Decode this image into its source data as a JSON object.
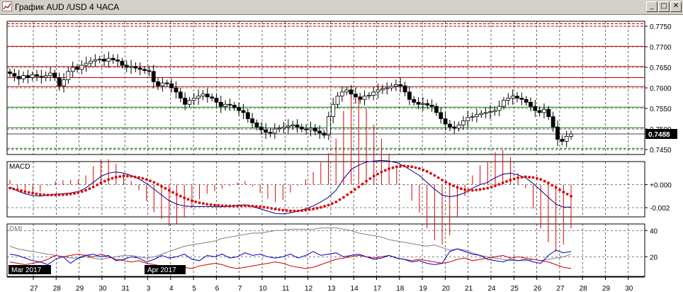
{
  "window": {
    "title": "График AUD /USD  4 ЧАСА",
    "buttons": {
      "minimize": "_",
      "maximize": "□",
      "close": "✕"
    }
  },
  "colors": {
    "background": "#ffffff",
    "grid": "#000000",
    "hline_red": "#c00000",
    "hline_green": "#008000",
    "macd_line": "#000080",
    "signal_dots": "#e00000",
    "histogram": "#e00000",
    "adx": "#808080",
    "di_plus": "#0000c0",
    "di_minus": "#d00000"
  },
  "chart_data": [
    {
      "type": "candlestick",
      "title": "График AUD /USD  4 ЧАСА",
      "current_price_label": "0.7488",
      "y_ticks": [
        "0.7750",
        "0.7700",
        "0.7650",
        "0.7600",
        "0.7550",
        "0.7500",
        "0.7450"
      ],
      "ylim": [
        0.7438,
        0.7762
      ],
      "horizontal_levels": [
        {
          "value": 0.7756,
          "color": "red",
          "style": "dashed"
        },
        {
          "value": 0.775,
          "color": "red",
          "style": "dashed"
        },
        {
          "value": 0.7701,
          "color": "red",
          "style": "solid"
        },
        {
          "value": 0.7652,
          "color": "red",
          "style": "solid"
        },
        {
          "value": 0.7625,
          "color": "red",
          "style": "solid"
        },
        {
          "value": 0.7603,
          "color": "red",
          "style": "solid"
        },
        {
          "value": 0.7553,
          "color": "green",
          "style": "solid"
        },
        {
          "value": 0.7503,
          "color": "green",
          "style": "solid"
        },
        {
          "value": 0.7453,
          "color": "green",
          "style": "dashed"
        }
      ],
      "closes": [
        0.7635,
        0.7628,
        0.7622,
        0.763,
        0.7625,
        0.7632,
        0.7628,
        0.7626,
        0.763,
        0.7636,
        0.7625,
        0.7605,
        0.762,
        0.764,
        0.765,
        0.7645,
        0.7655,
        0.766,
        0.7665,
        0.7668,
        0.767,
        0.7665,
        0.7672,
        0.7668,
        0.7665,
        0.7655,
        0.765,
        0.7652,
        0.7648,
        0.7645,
        0.7642,
        0.764,
        0.7615,
        0.7605,
        0.7612,
        0.761,
        0.76,
        0.759,
        0.7575,
        0.756,
        0.757,
        0.7575,
        0.758,
        0.7585,
        0.7578,
        0.7575,
        0.7565,
        0.7555,
        0.756,
        0.7558,
        0.7552,
        0.7545,
        0.754,
        0.7525,
        0.7515,
        0.7505,
        0.7498,
        0.7492,
        0.749,
        0.75,
        0.7502,
        0.7505,
        0.7508,
        0.751,
        0.7505,
        0.75,
        0.7498,
        0.7502,
        0.7495,
        0.749,
        0.7485,
        0.753,
        0.756,
        0.758,
        0.759,
        0.7595,
        0.7585,
        0.7578,
        0.7572,
        0.758,
        0.7582,
        0.759,
        0.7595,
        0.7598,
        0.76,
        0.7604,
        0.7608,
        0.7605,
        0.759,
        0.7572,
        0.7565,
        0.756,
        0.7562,
        0.7558,
        0.7555,
        0.754,
        0.7525,
        0.7512,
        0.7505,
        0.7502,
        0.751,
        0.752,
        0.7528,
        0.753,
        0.7535,
        0.7538,
        0.754,
        0.7542,
        0.7545,
        0.7555,
        0.757,
        0.7575,
        0.758,
        0.7575,
        0.7572,
        0.7565,
        0.7555,
        0.7545,
        0.754,
        0.7548,
        0.753,
        0.7505,
        0.7475,
        0.747,
        0.7482,
        0.7488
      ],
      "macd": {
        "label": "MACD",
        "y_ticks": [
          "+0.000",
          "-0.002"
        ],
        "ylim": [
          -0.0028,
          0.002
        ],
        "macd_line": [
          -0.0002,
          -0.00055,
          -0.0008,
          -0.00095,
          -0.001,
          -0.00092,
          -0.00083,
          -0.00078,
          -0.00072,
          -0.0006,
          -0.0003,
          0.0002,
          0.0007,
          0.001,
          0.0011,
          0.001,
          0.0008,
          0.0005,
          0.0001,
          -0.0004,
          -0.0009,
          -0.0014,
          -0.0017,
          -0.00185,
          -0.0019,
          -0.0019,
          -0.0019,
          -0.00192,
          -0.00192,
          -0.00188,
          -0.0018,
          -0.00175,
          -0.0019,
          -0.0021,
          -0.0023,
          -0.0025,
          -0.00255,
          -0.00245,
          -0.0023,
          -0.0021,
          -0.00185,
          -0.0015,
          -0.0011,
          -0.0005,
          0.0005,
          0.0013,
          0.0017,
          0.00195,
          0.00205,
          0.0021,
          0.00205,
          0.0019,
          0.0016,
          0.0012,
          0.0008,
          0.0002,
          -0.0004,
          -0.0009,
          -0.00105,
          -0.00095,
          -0.0007,
          -0.0003,
          0.0,
          0.0002,
          0.0006,
          0.0009,
          0.001,
          0.00085,
          0.0006,
          0.0001,
          -0.0005,
          -0.0011,
          -0.0017,
          -0.00195,
          -0.00195
        ],
        "signal_line": [
          -0.0003,
          -0.00045,
          -0.0006,
          -0.00075,
          -0.00085,
          -0.0009,
          -0.0009,
          -0.00088,
          -0.00082,
          -0.0007,
          -0.0005,
          -0.0002,
          0.00015,
          0.00045,
          0.00065,
          0.00075,
          0.00072,
          0.00062,
          0.00045,
          0.0002,
          -0.00015,
          -0.0005,
          -0.00085,
          -0.00115,
          -0.0014,
          -0.00158,
          -0.0017,
          -0.00178,
          -0.00183,
          -0.00185,
          -0.00185,
          -0.00183,
          -0.00186,
          -0.00192,
          -0.002,
          -0.00212,
          -0.00222,
          -0.00228,
          -0.00228,
          -0.00222,
          -0.00212,
          -0.00198,
          -0.00178,
          -0.0015,
          -0.0011,
          -0.00065,
          -0.0002,
          0.0003,
          0.00075,
          0.0011,
          0.00138,
          0.00155,
          0.00162,
          0.00155,
          0.0014,
          0.00115,
          0.0008,
          0.0004,
          5e-05,
          -0.00025,
          -0.00045,
          -0.0005,
          -0.00042,
          -0.0003,
          -0.0001,
          0.00015,
          0.0004,
          0.0006,
          0.00068,
          0.00062,
          0.00045,
          0.00015,
          -0.00025,
          -0.00065,
          -0.001
        ]
      },
      "dmi": {
        "label": "DMI",
        "y_ticks": [
          "40",
          "20"
        ],
        "ylim": [
          5,
          45
        ],
        "adx": [
          28,
          26,
          25,
          24,
          23,
          22,
          21,
          20,
          19,
          19,
          20,
          19,
          18,
          19,
          20,
          21,
          21,
          20,
          19,
          20,
          22,
          24,
          26,
          28,
          29,
          30,
          31,
          32,
          34,
          35,
          36,
          37,
          38,
          38,
          39,
          40,
          40,
          41,
          41,
          41,
          41,
          42,
          42,
          42,
          41,
          40,
          38,
          37,
          36,
          35,
          33,
          32,
          31,
          30,
          29,
          28,
          29,
          27,
          25,
          26,
          25,
          23,
          21,
          20,
          19,
          18,
          17,
          17,
          17,
          18,
          17,
          18,
          19,
          20,
          22
        ],
        "di_plus": [
          22,
          21,
          19,
          17,
          16,
          14,
          18,
          20,
          15,
          19,
          21,
          22,
          20,
          21,
          17,
          18,
          20,
          19,
          16,
          18,
          21,
          19,
          20,
          22,
          18,
          17,
          21,
          20,
          22,
          19,
          20,
          23,
          21,
          22,
          20,
          19,
          20,
          22,
          19,
          21,
          24,
          21,
          22,
          23,
          20,
          21,
          22,
          20,
          18,
          19,
          21,
          19,
          18,
          16,
          17,
          15,
          14,
          15,
          24,
          26,
          24,
          22,
          21,
          18,
          17,
          16,
          18,
          17,
          18,
          16,
          15,
          21,
          25,
          23,
          24
        ],
        "di_minus": [
          16,
          15,
          14,
          15,
          16,
          18,
          21,
          20,
          21,
          22,
          21,
          20,
          22,
          20,
          18,
          17,
          16,
          17,
          15,
          14,
          13,
          12,
          11,
          12,
          11,
          13,
          14,
          15,
          14,
          12,
          11,
          12,
          13,
          14,
          15,
          16,
          15,
          13,
          12,
          11,
          12,
          14,
          16,
          18,
          19,
          20,
          21,
          20,
          19,
          20,
          21,
          19,
          18,
          17,
          18,
          17,
          16,
          15,
          16,
          18,
          19,
          17,
          18,
          19,
          20,
          21,
          19,
          20,
          19,
          18,
          17,
          16,
          14,
          12,
          11
        ]
      },
      "x_ticks": [
        "27",
        "28",
        "29",
        "30",
        "31",
        "3",
        "4",
        "5",
        "6",
        "7",
        "10",
        "11",
        "12",
        "13",
        "14",
        "17",
        "18",
        "19",
        "20",
        "21",
        "24",
        "25",
        "26",
        "27",
        "28",
        "29",
        "30"
      ],
      "period_labels": [
        "Mar 2017",
        "Apr 2017"
      ]
    }
  ]
}
